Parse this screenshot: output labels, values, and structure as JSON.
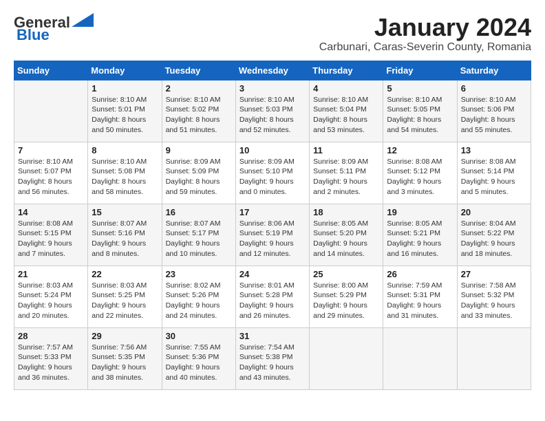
{
  "header": {
    "logo_general": "General",
    "logo_blue": "Blue",
    "month_title": "January 2024",
    "subtitle": "Carbunari, Caras-Severin County, Romania"
  },
  "days_of_week": [
    "Sunday",
    "Monday",
    "Tuesday",
    "Wednesday",
    "Thursday",
    "Friday",
    "Saturday"
  ],
  "weeks": [
    [
      {
        "day": "",
        "info": ""
      },
      {
        "day": "1",
        "info": "Sunrise: 8:10 AM\nSunset: 5:01 PM\nDaylight: 8 hours\nand 50 minutes."
      },
      {
        "day": "2",
        "info": "Sunrise: 8:10 AM\nSunset: 5:02 PM\nDaylight: 8 hours\nand 51 minutes."
      },
      {
        "day": "3",
        "info": "Sunrise: 8:10 AM\nSunset: 5:03 PM\nDaylight: 8 hours\nand 52 minutes."
      },
      {
        "day": "4",
        "info": "Sunrise: 8:10 AM\nSunset: 5:04 PM\nDaylight: 8 hours\nand 53 minutes."
      },
      {
        "day": "5",
        "info": "Sunrise: 8:10 AM\nSunset: 5:05 PM\nDaylight: 8 hours\nand 54 minutes."
      },
      {
        "day": "6",
        "info": "Sunrise: 8:10 AM\nSunset: 5:06 PM\nDaylight: 8 hours\nand 55 minutes."
      }
    ],
    [
      {
        "day": "7",
        "info": "Sunrise: 8:10 AM\nSunset: 5:07 PM\nDaylight: 8 hours\nand 56 minutes."
      },
      {
        "day": "8",
        "info": "Sunrise: 8:10 AM\nSunset: 5:08 PM\nDaylight: 8 hours\nand 58 minutes."
      },
      {
        "day": "9",
        "info": "Sunrise: 8:09 AM\nSunset: 5:09 PM\nDaylight: 8 hours\nand 59 minutes."
      },
      {
        "day": "10",
        "info": "Sunrise: 8:09 AM\nSunset: 5:10 PM\nDaylight: 9 hours\nand 0 minutes."
      },
      {
        "day": "11",
        "info": "Sunrise: 8:09 AM\nSunset: 5:11 PM\nDaylight: 9 hours\nand 2 minutes."
      },
      {
        "day": "12",
        "info": "Sunrise: 8:08 AM\nSunset: 5:12 PM\nDaylight: 9 hours\nand 3 minutes."
      },
      {
        "day": "13",
        "info": "Sunrise: 8:08 AM\nSunset: 5:14 PM\nDaylight: 9 hours\nand 5 minutes."
      }
    ],
    [
      {
        "day": "14",
        "info": "Sunrise: 8:08 AM\nSunset: 5:15 PM\nDaylight: 9 hours\nand 7 minutes."
      },
      {
        "day": "15",
        "info": "Sunrise: 8:07 AM\nSunset: 5:16 PM\nDaylight: 9 hours\nand 8 minutes."
      },
      {
        "day": "16",
        "info": "Sunrise: 8:07 AM\nSunset: 5:17 PM\nDaylight: 9 hours\nand 10 minutes."
      },
      {
        "day": "17",
        "info": "Sunrise: 8:06 AM\nSunset: 5:19 PM\nDaylight: 9 hours\nand 12 minutes."
      },
      {
        "day": "18",
        "info": "Sunrise: 8:05 AM\nSunset: 5:20 PM\nDaylight: 9 hours\nand 14 minutes."
      },
      {
        "day": "19",
        "info": "Sunrise: 8:05 AM\nSunset: 5:21 PM\nDaylight: 9 hours\nand 16 minutes."
      },
      {
        "day": "20",
        "info": "Sunrise: 8:04 AM\nSunset: 5:22 PM\nDaylight: 9 hours\nand 18 minutes."
      }
    ],
    [
      {
        "day": "21",
        "info": "Sunrise: 8:03 AM\nSunset: 5:24 PM\nDaylight: 9 hours\nand 20 minutes."
      },
      {
        "day": "22",
        "info": "Sunrise: 8:03 AM\nSunset: 5:25 PM\nDaylight: 9 hours\nand 22 minutes."
      },
      {
        "day": "23",
        "info": "Sunrise: 8:02 AM\nSunset: 5:26 PM\nDaylight: 9 hours\nand 24 minutes."
      },
      {
        "day": "24",
        "info": "Sunrise: 8:01 AM\nSunset: 5:28 PM\nDaylight: 9 hours\nand 26 minutes."
      },
      {
        "day": "25",
        "info": "Sunrise: 8:00 AM\nSunset: 5:29 PM\nDaylight: 9 hours\nand 29 minutes."
      },
      {
        "day": "26",
        "info": "Sunrise: 7:59 AM\nSunset: 5:31 PM\nDaylight: 9 hours\nand 31 minutes."
      },
      {
        "day": "27",
        "info": "Sunrise: 7:58 AM\nSunset: 5:32 PM\nDaylight: 9 hours\nand 33 minutes."
      }
    ],
    [
      {
        "day": "28",
        "info": "Sunrise: 7:57 AM\nSunset: 5:33 PM\nDaylight: 9 hours\nand 36 minutes."
      },
      {
        "day": "29",
        "info": "Sunrise: 7:56 AM\nSunset: 5:35 PM\nDaylight: 9 hours\nand 38 minutes."
      },
      {
        "day": "30",
        "info": "Sunrise: 7:55 AM\nSunset: 5:36 PM\nDaylight: 9 hours\nand 40 minutes."
      },
      {
        "day": "31",
        "info": "Sunrise: 7:54 AM\nSunset: 5:38 PM\nDaylight: 9 hours\nand 43 minutes."
      },
      {
        "day": "",
        "info": ""
      },
      {
        "day": "",
        "info": ""
      },
      {
        "day": "",
        "info": ""
      }
    ]
  ]
}
